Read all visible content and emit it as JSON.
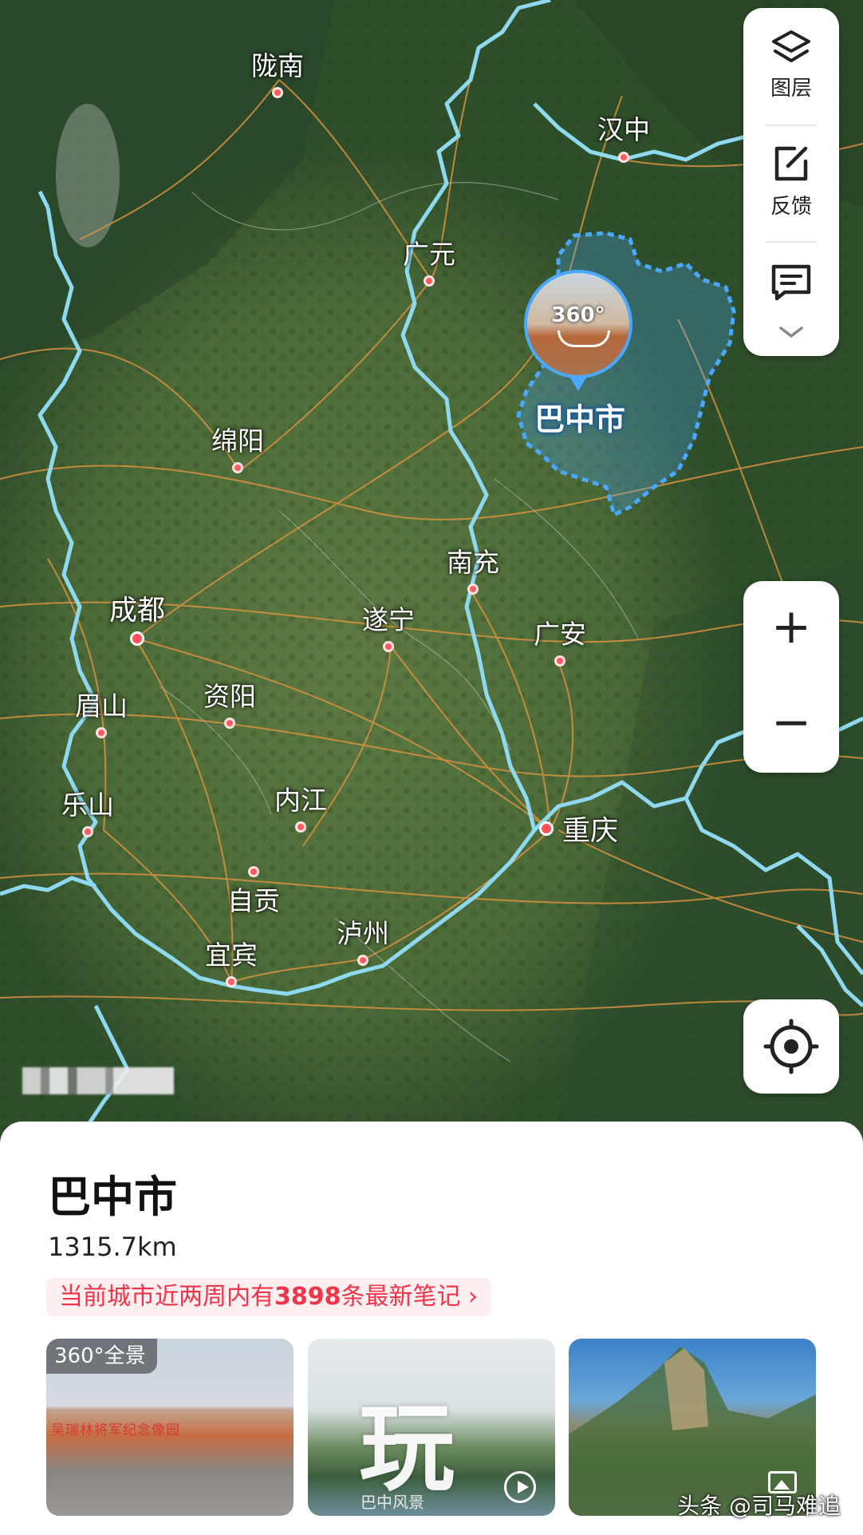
{
  "map": {
    "cities": [
      {
        "name": "陇南"
      },
      {
        "name": "汉中"
      },
      {
        "name": "广元"
      },
      {
        "name": "绵阳"
      },
      {
        "name": "南充"
      },
      {
        "name": "成都"
      },
      {
        "name": "遂宁"
      },
      {
        "name": "广安"
      },
      {
        "name": "眉山"
      },
      {
        "name": "资阳"
      },
      {
        "name": "乐山"
      },
      {
        "name": "内江"
      },
      {
        "name": "重庆"
      },
      {
        "name": "自贡"
      },
      {
        "name": "泸州"
      },
      {
        "name": "宜宾"
      }
    ],
    "selected_region": "巴中市",
    "pano_label": "360°"
  },
  "toolbar": {
    "layers_label": "图层",
    "feedback_label": "反馈"
  },
  "zoom": {
    "in": "+",
    "out": "−"
  },
  "sheet": {
    "title": "巴中市",
    "distance": "1315.7km",
    "notes_prefix": "当前城市近两周内有",
    "notes_count": "3898",
    "notes_suffix": "条最新笔记 ›",
    "cards": [
      {
        "badge": "360°全景",
        "sign": "吴瑞林将军纪念像园"
      },
      {
        "big": "玩",
        "caption": "巴中风景"
      },
      {}
    ]
  },
  "watermark": "头条 @司马难追",
  "colors": {
    "accent": "#f0344a",
    "region": "#4aa8ff",
    "river": "#8fd9f0",
    "road": "#d8923f"
  }
}
